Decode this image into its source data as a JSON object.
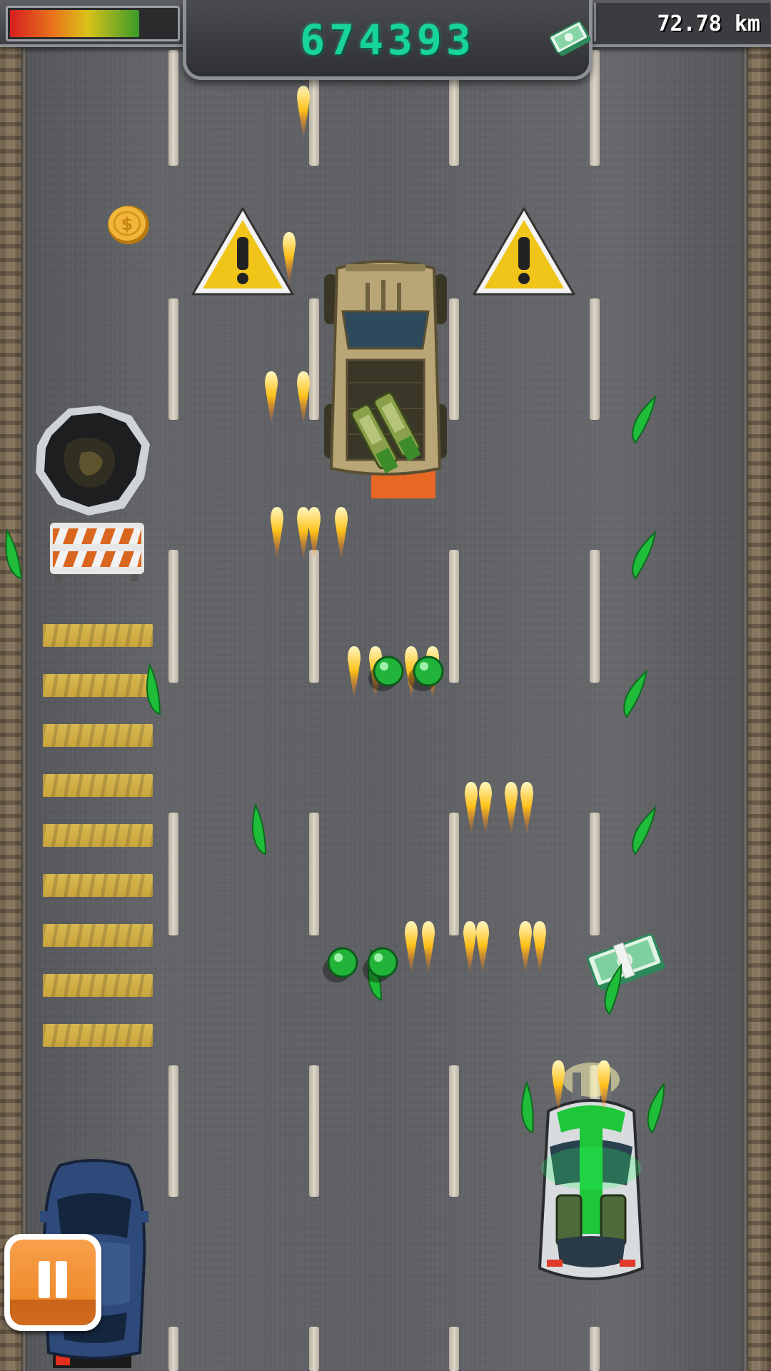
{
  "hud": {
    "health_fraction": 0.78,
    "score": "674393",
    "distance": "72.78 km",
    "cash_icon": "cash-stack-icon"
  },
  "controls": {
    "pause_icon": "pause-icon"
  },
  "colors": {
    "score_text": "#18d39a",
    "health_gradient": [
      "#d61f1f",
      "#e9781a",
      "#d9c21a",
      "#3a9a2a"
    ],
    "pause_button": "#ef8a2c",
    "player_car_accent": "#1ec63a",
    "enemy_truck": "#b9a676"
  },
  "entities": {
    "warning_signs": [
      "warning-triangle-icon",
      "warning-triangle-icon"
    ],
    "enemy": "armored-truck-with-turret",
    "player": "player-sports-car-with-guns",
    "traffic": "blue-civilian-car",
    "pickups": [
      "gold-coin-icon",
      "cash-bundle-icon"
    ],
    "hazards": [
      "pothole",
      "road-barrier"
    ]
  }
}
